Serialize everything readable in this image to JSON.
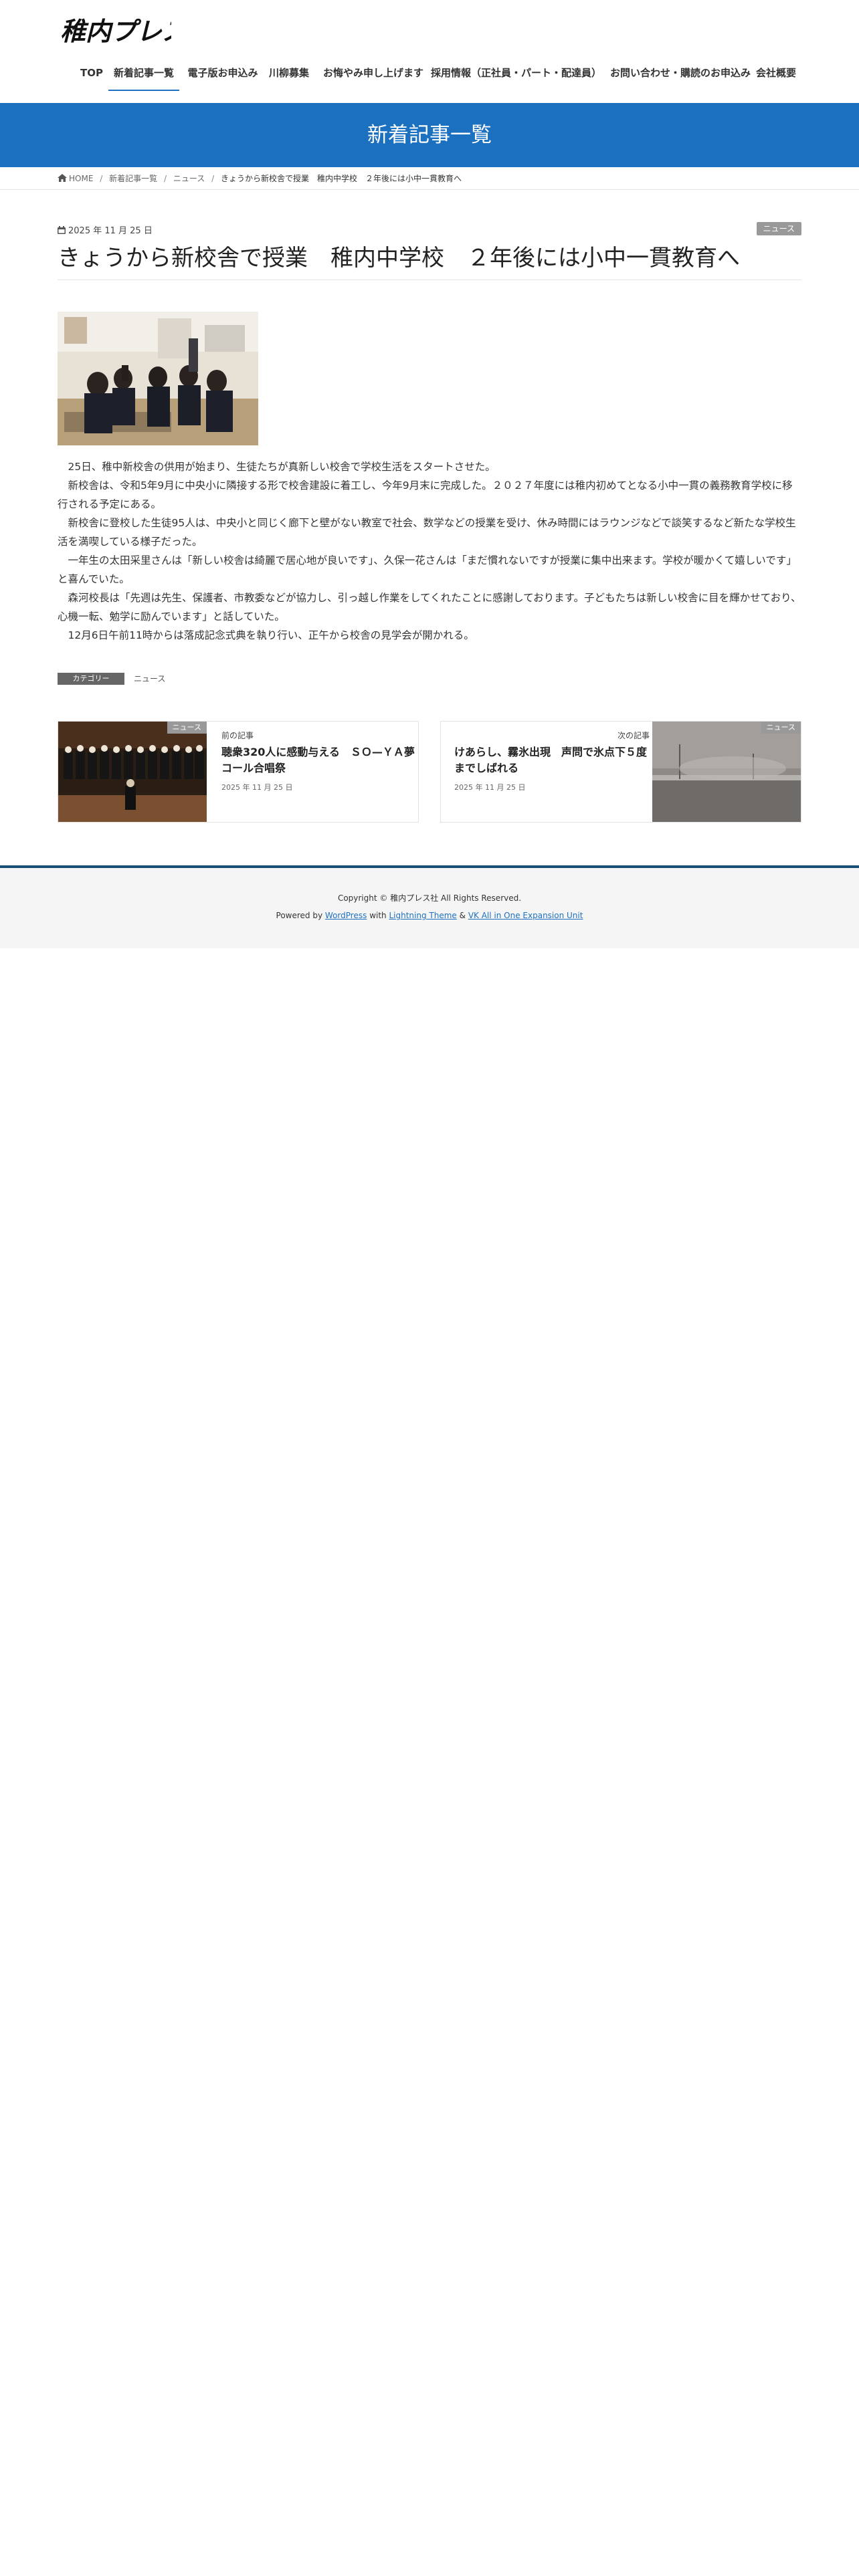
{
  "header": {
    "logo_text": "稚内プレス",
    "nav": [
      {
        "label": "TOP"
      },
      {
        "label": "新着記事一覧",
        "active": true
      },
      {
        "label": "電子版お申込み"
      },
      {
        "label": "川柳募集"
      },
      {
        "label": "お悔やみ申し上げます"
      },
      {
        "label": "採用情報（正社員・パート・配達員）"
      },
      {
        "label": "お問い合わせ・購読のお申込み"
      },
      {
        "label": "会社概要"
      }
    ]
  },
  "page_header": {
    "title": "新着記事一覧",
    "bg_color": "#1c70c0"
  },
  "breadcrumb": {
    "home": "HOME",
    "items": [
      "新着記事一覧",
      "ニュース",
      "きょうから新校舎で授業　稚内中学校　２年後には小中一貫教育へ"
    ]
  },
  "article": {
    "date": "2025 年 11 月 25 日",
    "category": "ニュース",
    "title": "きょうから新校舎で授業　稚内中学校　２年後には小中一貫教育へ",
    "paragraphs": [
      "　25日、稚中新校舎の供用が始まり、生徒たちが真新しい校舎で学校生活をスタートさせた。",
      "　新校舎は、令和5年9月に中央小に隣接する形で校舎建設に着工し、今年9月末に完成した。２０２７年度には稚内初めてとなる小中一貫の義務教育学校に移行される予定にある。",
      "　新校舎に登校した生徒95人は、中央小と同じく廊下と壁がない教室で社会、数学などの授業を受け、休み時間にはラウンジなどで談笑するなど新たな学校生活を満喫している様子だった。",
      "　一年生の太田采里さんは「新しい校舎は綺麗で居心地が良いです」、久保一花さんは「まだ慣れないですが授業に集中出来ます。学校が暖かくて嬉しいです」と喜んでいた。",
      "　森河校長は「先週は先生、保護者、市教委などが協力し、引っ越し作業をしてくれたことに感謝しております。子どもたちは新しい校舎に目を輝かせており、心機一転、勉学に励んでいます」と話していた。",
      "　12月6日午前11時からは落成記念式典を執り行い、正午から校舎の見学会が開かれる。"
    ],
    "taxonomy_label": "カテゴリー",
    "taxonomy_value": "ニュース"
  },
  "pager": {
    "prev": {
      "kind": "前の記事",
      "badge": "ニュース",
      "title": "聴衆320人に感動与える　ＳＯ—ＹＡ夢コール合唱祭",
      "date": "2025 年 11 月 25 日"
    },
    "next": {
      "kind": "次の記事",
      "badge": "ニュース",
      "title": "けあらし、霧氷出現　声問で氷点下５度までしばれる",
      "date": "2025 年 11 月 25 日"
    }
  },
  "footer": {
    "copyright": "Copyright © 稚内プレス社 All Rights Reserved.",
    "powered_prefix": "Powered by",
    "powered_wp": "WordPress",
    "powered_with": "with",
    "powered_theme": "Lightning Theme",
    "powered_amp": "&",
    "powered_unit": "VK All in One Expansion Unit"
  }
}
